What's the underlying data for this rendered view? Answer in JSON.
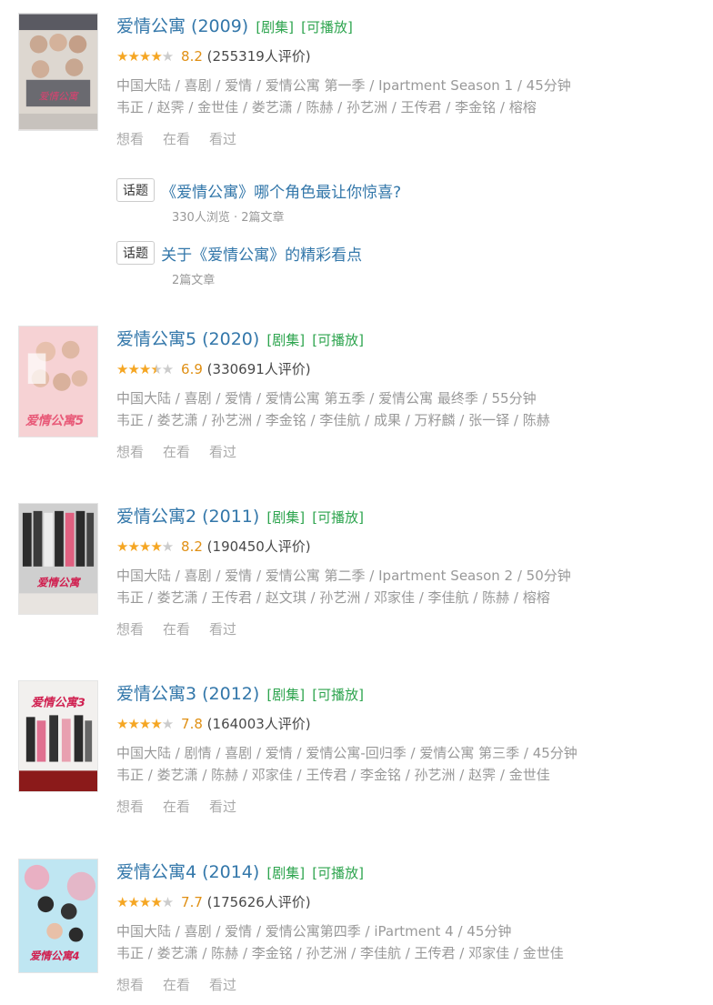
{
  "items": [
    {
      "title": "爱情公寓 (2009)",
      "tags": [
        "[剧集]",
        "[可播放]"
      ],
      "rating": {
        "stars": 4,
        "score": "8.2",
        "votes": "(255319人评价)"
      },
      "meta1": "中国大陆 / 喜剧 / 爱情 / 爱情公寓 第一季 / Ipartment Season 1 / 45分钟",
      "meta2": "韦正 / 赵霁 / 金世佳 / 娄艺潇 / 陈赫 / 孙艺洲 / 王传君 / 李金铭 / 榕榕",
      "actions": [
        "想看",
        "在看",
        "看过"
      ],
      "poster_colors": [
        "#ddd7d0",
        "#6a6a70"
      ]
    },
    {
      "title": "爱情公寓5 (2020)",
      "tags": [
        "[剧集]",
        "[可播放]"
      ],
      "rating": {
        "stars": 3.5,
        "score": "6.9",
        "votes": "(330691人评价)"
      },
      "meta1": "中国大陆 / 喜剧 / 爱情 / 爱情公寓 第五季 / 爱情公寓 最终季 / 55分钟",
      "meta2": "韦正 / 娄艺潇 / 孙艺洲 / 李金铭 / 李佳航 / 成果 / 万籽麟 / 张一铎 / 陈赫",
      "actions": [
        "想看",
        "在看",
        "看过"
      ],
      "poster_colors": [
        "#f6d2d4",
        "#e85a78"
      ]
    },
    {
      "title": "爱情公寓2 (2011)",
      "tags": [
        "[剧集]",
        "[可播放]"
      ],
      "rating": {
        "stars": 4,
        "score": "8.2",
        "votes": "(190450人评价)"
      },
      "meta1": "中国大陆 / 喜剧 / 爱情 / 爱情公寓 第二季 / Ipartment Season 2 / 50分钟",
      "meta2": "韦正 / 娄艺潇 / 王传君 / 赵文琪 / 孙艺洲 / 邓家佳 / 李佳航 / 陈赫 / 榕榕",
      "actions": [
        "想看",
        "在看",
        "看过"
      ],
      "poster_colors": [
        "#cfcfcf",
        "#2b2b2b"
      ]
    },
    {
      "title": "爱情公寓3 (2012)",
      "tags": [
        "[剧集]",
        "[可播放]"
      ],
      "rating": {
        "stars": 4,
        "score": "7.8",
        "votes": "(164003人评价)"
      },
      "meta1": "中国大陆 / 剧情 / 喜剧 / 爱情 / 爱情公寓-回归季 / 爱情公寓 第三季 / 45分钟",
      "meta2": "韦正 / 娄艺潇 / 陈赫 / 邓家佳 / 王传君 / 李金铭 / 孙艺洲 / 赵霁 / 金世佳",
      "actions": [
        "想看",
        "在看",
        "看过"
      ],
      "poster_colors": [
        "#f2f0ee",
        "#8b1a1a"
      ]
    },
    {
      "title": "爱情公寓4 (2014)",
      "tags": [
        "[剧集]",
        "[可播放]"
      ],
      "rating": {
        "stars": 4,
        "score": "7.7",
        "votes": "(175626人评价)"
      },
      "meta1": "中国大陆 / 喜剧 / 爱情 / 爱情公寓第四季 / iPartment 4 / 45分钟",
      "meta2": "韦正 / 娄艺潇 / 陈赫 / 李金铭 / 孙艺洲 / 李佳航 / 王传君 / 邓家佳 / 金世佳",
      "actions": [
        "想看",
        "在看",
        "看过"
      ],
      "poster_colors": [
        "#bfe6f2",
        "#f4a3b6"
      ]
    }
  ],
  "topics": [
    {
      "badge": "话题",
      "title": "《爱情公寓》哪个角色最让你惊喜?",
      "sub": "330人浏览 · 2篇文章"
    },
    {
      "badge": "话题",
      "title": "关于《爱情公寓》的精彩看点",
      "sub": "2篇文章"
    }
  ],
  "poster_logos": [
    "爱情公寓",
    "爱情公寓5",
    "爱情公寓",
    "爱情公寓3",
    "爱情公寓4"
  ]
}
